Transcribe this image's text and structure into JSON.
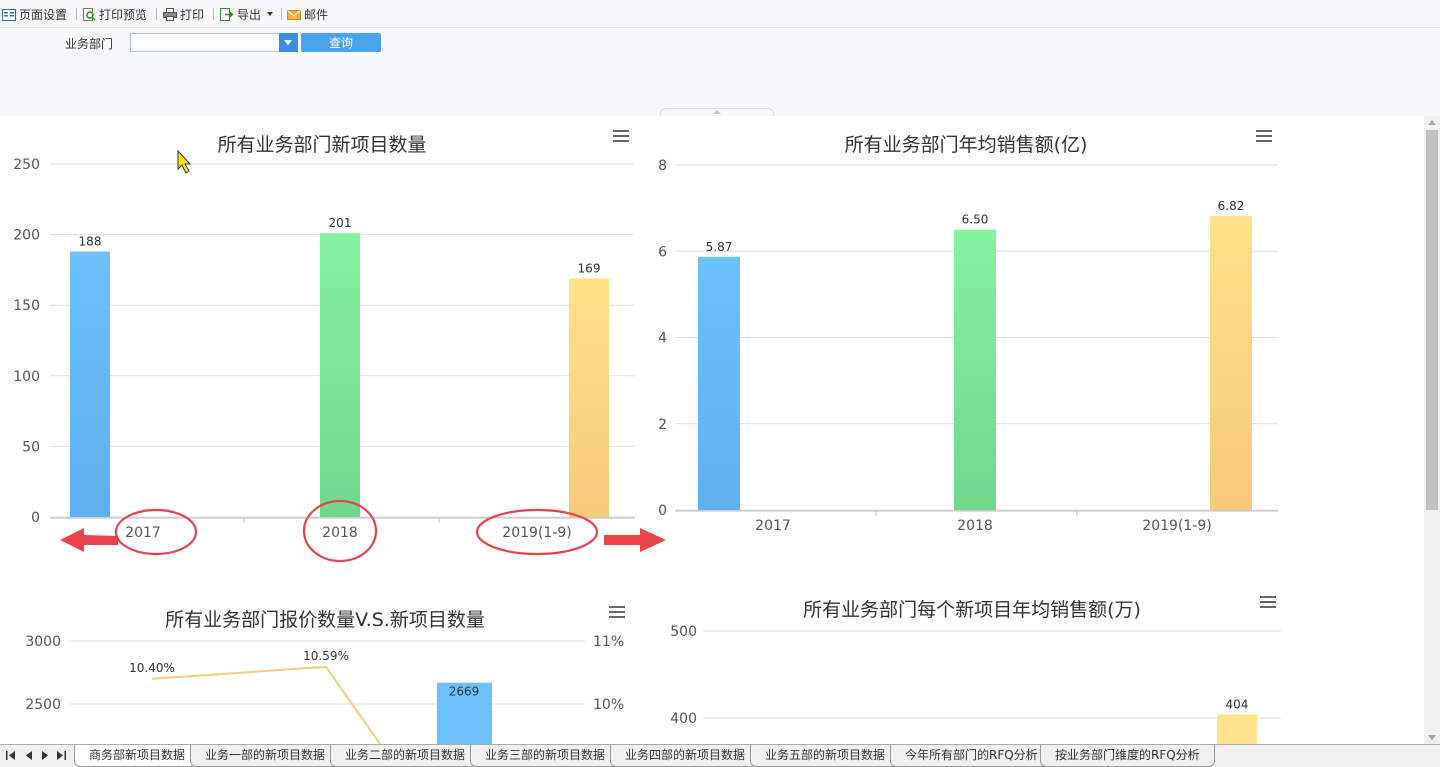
{
  "toolbar": {
    "page_setup": "页面设置",
    "print_preview": "打印预览",
    "print": "打印",
    "export": "导出",
    "mail": "邮件"
  },
  "filter": {
    "label": "业务部门",
    "select_value": "",
    "query_button": "查询"
  },
  "tabs": [
    "商务部新项目数据",
    "业务一部的新项目数据",
    "业务二部的新项目数据",
    "业务三部的新项目数据",
    "业务四部的新项目数据",
    "业务五部的新项目数据",
    "今年所有部门的RFQ分析",
    "按业务部门维度的RFQ分析"
  ],
  "active_tab": 0,
  "colors": {
    "bar_blue_top": "#6cc0fe",
    "bar_blue_bottom": "#5eb0ee",
    "bar_green_top": "#85f29f",
    "bar_green_bottom": "#6fd88c",
    "bar_yellow_top": "#ffe28a",
    "bar_yellow_bottom": "#f7c97a",
    "line": "#f7c97a",
    "annotation_red": "#e8434a"
  },
  "chart_data": [
    {
      "type": "bar",
      "title": "所有业务部门新项目数量",
      "categories": [
        "2017",
        "2018",
        "2019(1-9)"
      ],
      "values": [
        188,
        201,
        169
      ],
      "value_labels": [
        "188",
        "201",
        "169"
      ],
      "yticks": [
        "0",
        "50",
        "100",
        "150",
        "200",
        "250"
      ],
      "ylim": [
        0,
        250
      ],
      "grid": true
    },
    {
      "type": "bar",
      "title": "所有业务部门年均销售额(亿)",
      "categories": [
        "2017",
        "2018",
        "2019(1-9)"
      ],
      "values": [
        5.87,
        6.5,
        6.82
      ],
      "value_labels": [
        "5.87",
        "6.50",
        "6.82"
      ],
      "yticks": [
        "0",
        "2",
        "4",
        "6",
        "8"
      ],
      "ylim": [
        0,
        8
      ],
      "grid": true
    },
    {
      "type": "bar",
      "title": "所有业务部门报价数量V.S.新项目数量",
      "bar_values": [
        2669
      ],
      "bar_labels": [
        "2669"
      ],
      "line_values": [
        10.4,
        10.59
      ],
      "line_labels": [
        "10.40%",
        "10.59%"
      ],
      "yticks_left": [
        "2500",
        "3000"
      ],
      "yticks_right": [
        "10%",
        "11%"
      ],
      "grid": true
    },
    {
      "type": "bar",
      "title": "所有业务部门每个新项目年均销售额(万)",
      "values": [
        404
      ],
      "value_labels": [
        "404"
      ],
      "yticks": [
        "400",
        "500"
      ],
      "grid": true
    }
  ]
}
